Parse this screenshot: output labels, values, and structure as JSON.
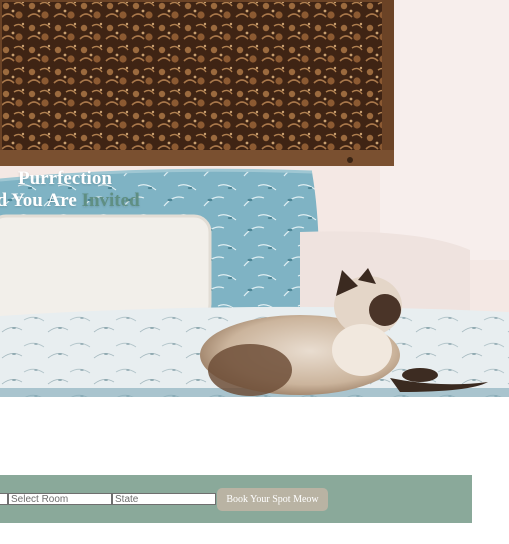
{
  "hero": {
    "title_line1": "Purrfection",
    "title_line2_main": "nd You Are ",
    "title_line2_accent": "Invited"
  },
  "booking": {
    "room_placeholder": "Select Room",
    "state_placeholder": "State",
    "button_label": "Book Your Spot Meow"
  },
  "colors": {
    "booking_bar": "#8aa99a",
    "button": "#b9b3a3",
    "title_accent": "#5f8f83"
  }
}
